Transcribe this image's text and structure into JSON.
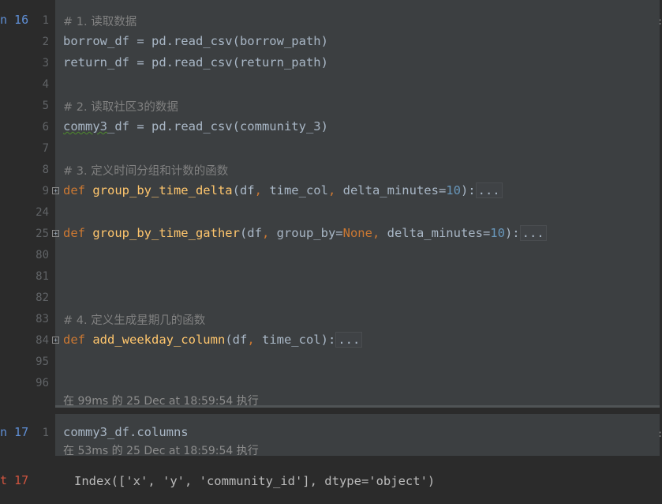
{
  "cell1": {
    "prompt": "n 16",
    "lines": [
      {
        "num": "1",
        "text": "# 1. 读取数据"
      },
      {
        "num": "2",
        "text": "borrow_df = pd.read_csv(borrow_path)"
      },
      {
        "num": "3",
        "text": "return_df = pd.read_csv(return_path)"
      },
      {
        "num": "4",
        "text": ""
      },
      {
        "num": "5",
        "text": "# 2. 读取社区3的数据"
      },
      {
        "num": "6",
        "text": "commy3_df = pd.read_csv(community_3)"
      },
      {
        "num": "7",
        "text": ""
      },
      {
        "num": "8",
        "text": "# 3. 定义时间分组和计数的函数"
      },
      {
        "num": "9",
        "text": "def group_by_time_delta(df, time_col, delta_minutes=10):..."
      },
      {
        "num": "24",
        "text": ""
      },
      {
        "num": "25",
        "text": "def group_by_time_gather(df, group_by=None, delta_minutes=10):..."
      },
      {
        "num": "80",
        "text": ""
      },
      {
        "num": "81",
        "text": ""
      },
      {
        "num": "82",
        "text": ""
      },
      {
        "num": "83",
        "text": "# 4. 定义生成星期几的函数"
      },
      {
        "num": "84",
        "text": "def add_weekday_column(df, time_col):..."
      },
      {
        "num": "95",
        "text": ""
      },
      {
        "num": "96",
        "text": ""
      }
    ],
    "exec_info": "在 99ms 的 25 Dec at 18:59:54 执行"
  },
  "cell2": {
    "prompt": "n 17",
    "lines": [
      {
        "num": "1",
        "text": "commy3_df.columns"
      }
    ],
    "exec_info": "在 53ms 的 25 Dec at 18:59:54 执行"
  },
  "output": {
    "prompt": "t 17",
    "text": "Index(['x', 'y', 'community_id'], dtype='object')"
  },
  "colors": {
    "background": "#2b2b2b",
    "cell_background": "#3c3f41",
    "keyword": "#cc7832",
    "function": "#ffc66d",
    "number": "#6897bb",
    "comment": "#808080",
    "prompt_in": "#5f8fd6",
    "prompt_out": "#d1543f"
  }
}
